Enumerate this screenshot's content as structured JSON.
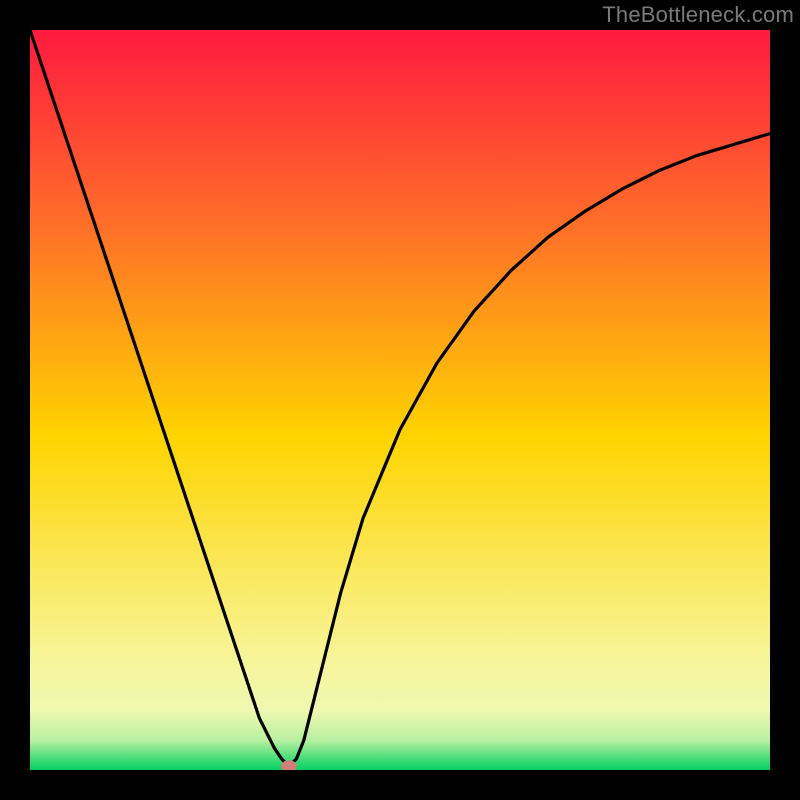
{
  "watermark": "TheBottleneck.com",
  "chart_data": {
    "type": "line",
    "title": "",
    "xlabel": "",
    "ylabel": "",
    "xlim": [
      0,
      100
    ],
    "ylim": [
      0,
      100
    ],
    "gradient": {
      "top_color": "#ff1a3f",
      "mid_color": "#ffd400",
      "bottom_edge_color": "#00d060",
      "bottom_band_start": 0.9
    },
    "minimum_marker": {
      "x": 35,
      "y": 0.5,
      "color": "#d08078"
    },
    "series": [
      {
        "name": "bottleneck-curve",
        "x": [
          0,
          2,
          4,
          6,
          8,
          10,
          12,
          14,
          16,
          18,
          20,
          22,
          24,
          26,
          28,
          30,
          31,
          32,
          33,
          34,
          35,
          36,
          37,
          38,
          40,
          42,
          45,
          50,
          55,
          60,
          65,
          70,
          75,
          80,
          85,
          90,
          95,
          100
        ],
        "y": [
          100,
          94,
          88,
          82,
          76,
          70,
          64,
          58,
          52,
          46,
          40,
          34,
          28,
          22,
          16,
          10,
          7,
          5,
          3,
          1.5,
          0.5,
          1.5,
          4,
          8,
          16,
          24,
          34,
          46,
          55,
          62,
          67.5,
          72,
          75.5,
          78.5,
          81,
          83,
          84.5,
          86
        ]
      }
    ]
  }
}
